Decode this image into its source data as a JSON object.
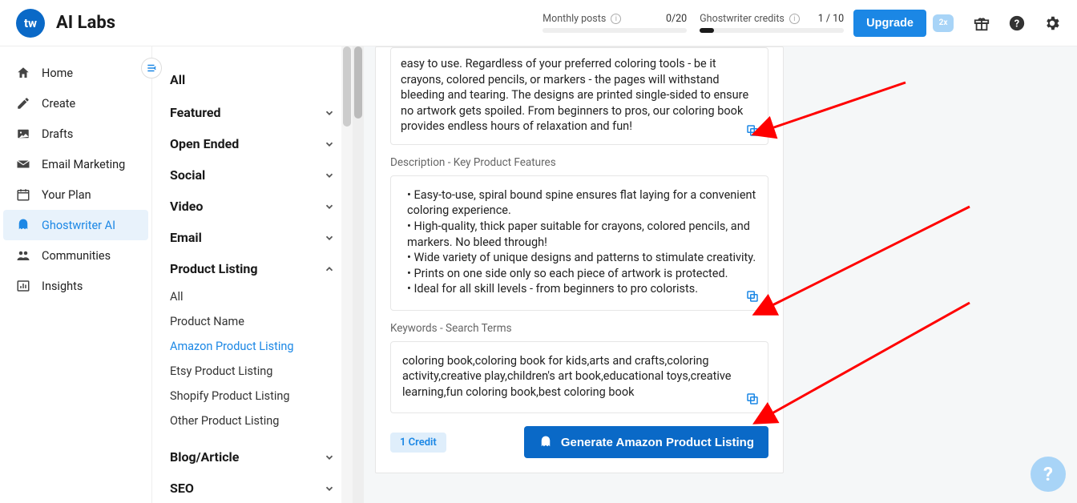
{
  "header": {
    "logo_text": "tw",
    "title": "AI Labs",
    "monthly_label": "Monthly posts",
    "monthly_value": "0/20",
    "ghost_label": "Ghostwriter credits",
    "ghost_value": "1 / 10",
    "upgrade_label": "Upgrade",
    "heart_badge": "2x"
  },
  "sidebar1": {
    "items": [
      {
        "label": "Home"
      },
      {
        "label": "Create"
      },
      {
        "label": "Drafts"
      },
      {
        "label": "Email Marketing"
      },
      {
        "label": "Your Plan"
      },
      {
        "label": "Ghostwriter AI"
      },
      {
        "label": "Communities"
      },
      {
        "label": "Insights"
      }
    ]
  },
  "sidebar2": {
    "all_label": "All",
    "categories": {
      "featured": "Featured",
      "open_ended": "Open Ended",
      "social": "Social",
      "video": "Video",
      "email": "Email",
      "product_listing": "Product Listing",
      "blog_article": "Blog/Article",
      "seo": "SEO"
    },
    "product_listing_items": [
      {
        "label": "All"
      },
      {
        "label": "Product Name"
      },
      {
        "label": "Amazon Product Listing"
      },
      {
        "label": "Etsy Product Listing"
      },
      {
        "label": "Shopify Product Listing"
      },
      {
        "label": "Other Product Listing"
      }
    ]
  },
  "form": {
    "top_text": "easy to use. Regardless of your preferred coloring tools - be it crayons, colored pencils, or markers - the pages will withstand bleeding and tearing. The designs are printed single-sided to ensure no artwork gets spoiled. From beginners to pros, our coloring book provides endless hours of relaxation and fun!",
    "features_label": "Description - Key Product Features",
    "features_lines": [
      "•   Easy-to-use, spiral bound spine ensures flat laying for a convenient coloring experience.",
      "•   High-quality, thick paper suitable for crayons, colored pencils, and markers. No bleed through!",
      "•   Wide variety of unique designs and patterns to stimulate creativity.",
      "•   Prints on one side only so each piece of artwork is protected.",
      "•   Ideal for all skill levels - from beginners to pro colorists."
    ],
    "keywords_label": "Keywords - Search Terms",
    "keywords_text": "coloring book,coloring book for kids,arts and crafts,coloring activity,creative play,children's art book,educational toys,creative learning,fun coloring book,best coloring book",
    "credit_label": "1 Credit",
    "generate_label": "Generate Amazon Product Listing"
  },
  "help_label": "?"
}
